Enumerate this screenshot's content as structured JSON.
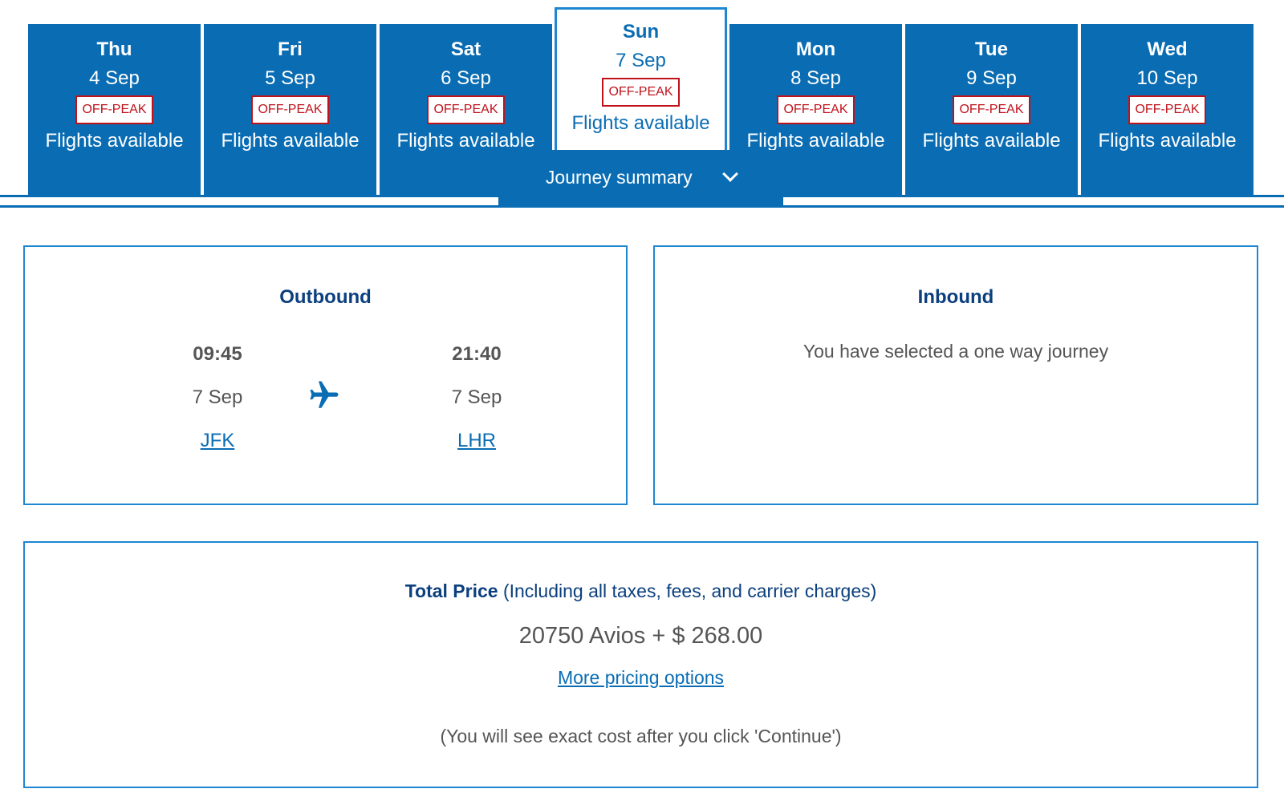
{
  "dates": [
    {
      "dow": "Thu",
      "dm": "4 Sep",
      "badge": "OFF-PEAK",
      "status": "Flights available",
      "selected": false
    },
    {
      "dow": "Fri",
      "dm": "5 Sep",
      "badge": "OFF-PEAK",
      "status": "Flights available",
      "selected": false
    },
    {
      "dow": "Sat",
      "dm": "6 Sep",
      "badge": "OFF-PEAK",
      "status": "Flights available",
      "selected": false
    },
    {
      "dow": "Sun",
      "dm": "7 Sep",
      "badge": "OFF-PEAK",
      "status": "Flights available",
      "selected": true
    },
    {
      "dow": "Mon",
      "dm": "8 Sep",
      "badge": "OFF-PEAK",
      "status": "Flights available",
      "selected": false
    },
    {
      "dow": "Tue",
      "dm": "9 Sep",
      "badge": "OFF-PEAK",
      "status": "Flights available",
      "selected": false
    },
    {
      "dow": "Wed",
      "dm": "10 Sep",
      "badge": "OFF-PEAK",
      "status": "Flights available",
      "selected": false
    }
  ],
  "summary": {
    "label": "Journey summary",
    "icon": "chevron-down-icon"
  },
  "outbound": {
    "title": "Outbound",
    "depart": {
      "time": "09:45",
      "date": "7 Sep",
      "airport": "JFK"
    },
    "arrive": {
      "time": "21:40",
      "date": "7 Sep",
      "airport": "LHR"
    },
    "icon": "plane-icon"
  },
  "inbound": {
    "title": "Inbound",
    "note": "You have selected a one way journey"
  },
  "price": {
    "label": "Total Price",
    "qualifier": "(Including all taxes, fees, and carrier charges)",
    "amount": "20750 Avios + $ 268.00",
    "more_link": "More pricing options",
    "footnote": "(You will see exact cost after you click 'Continue')"
  },
  "colors": {
    "brand_blue": "#0a6db4",
    "navy_text": "#0b3f7e",
    "offpeak_red": "#c0121b",
    "body_gray": "#555555"
  }
}
